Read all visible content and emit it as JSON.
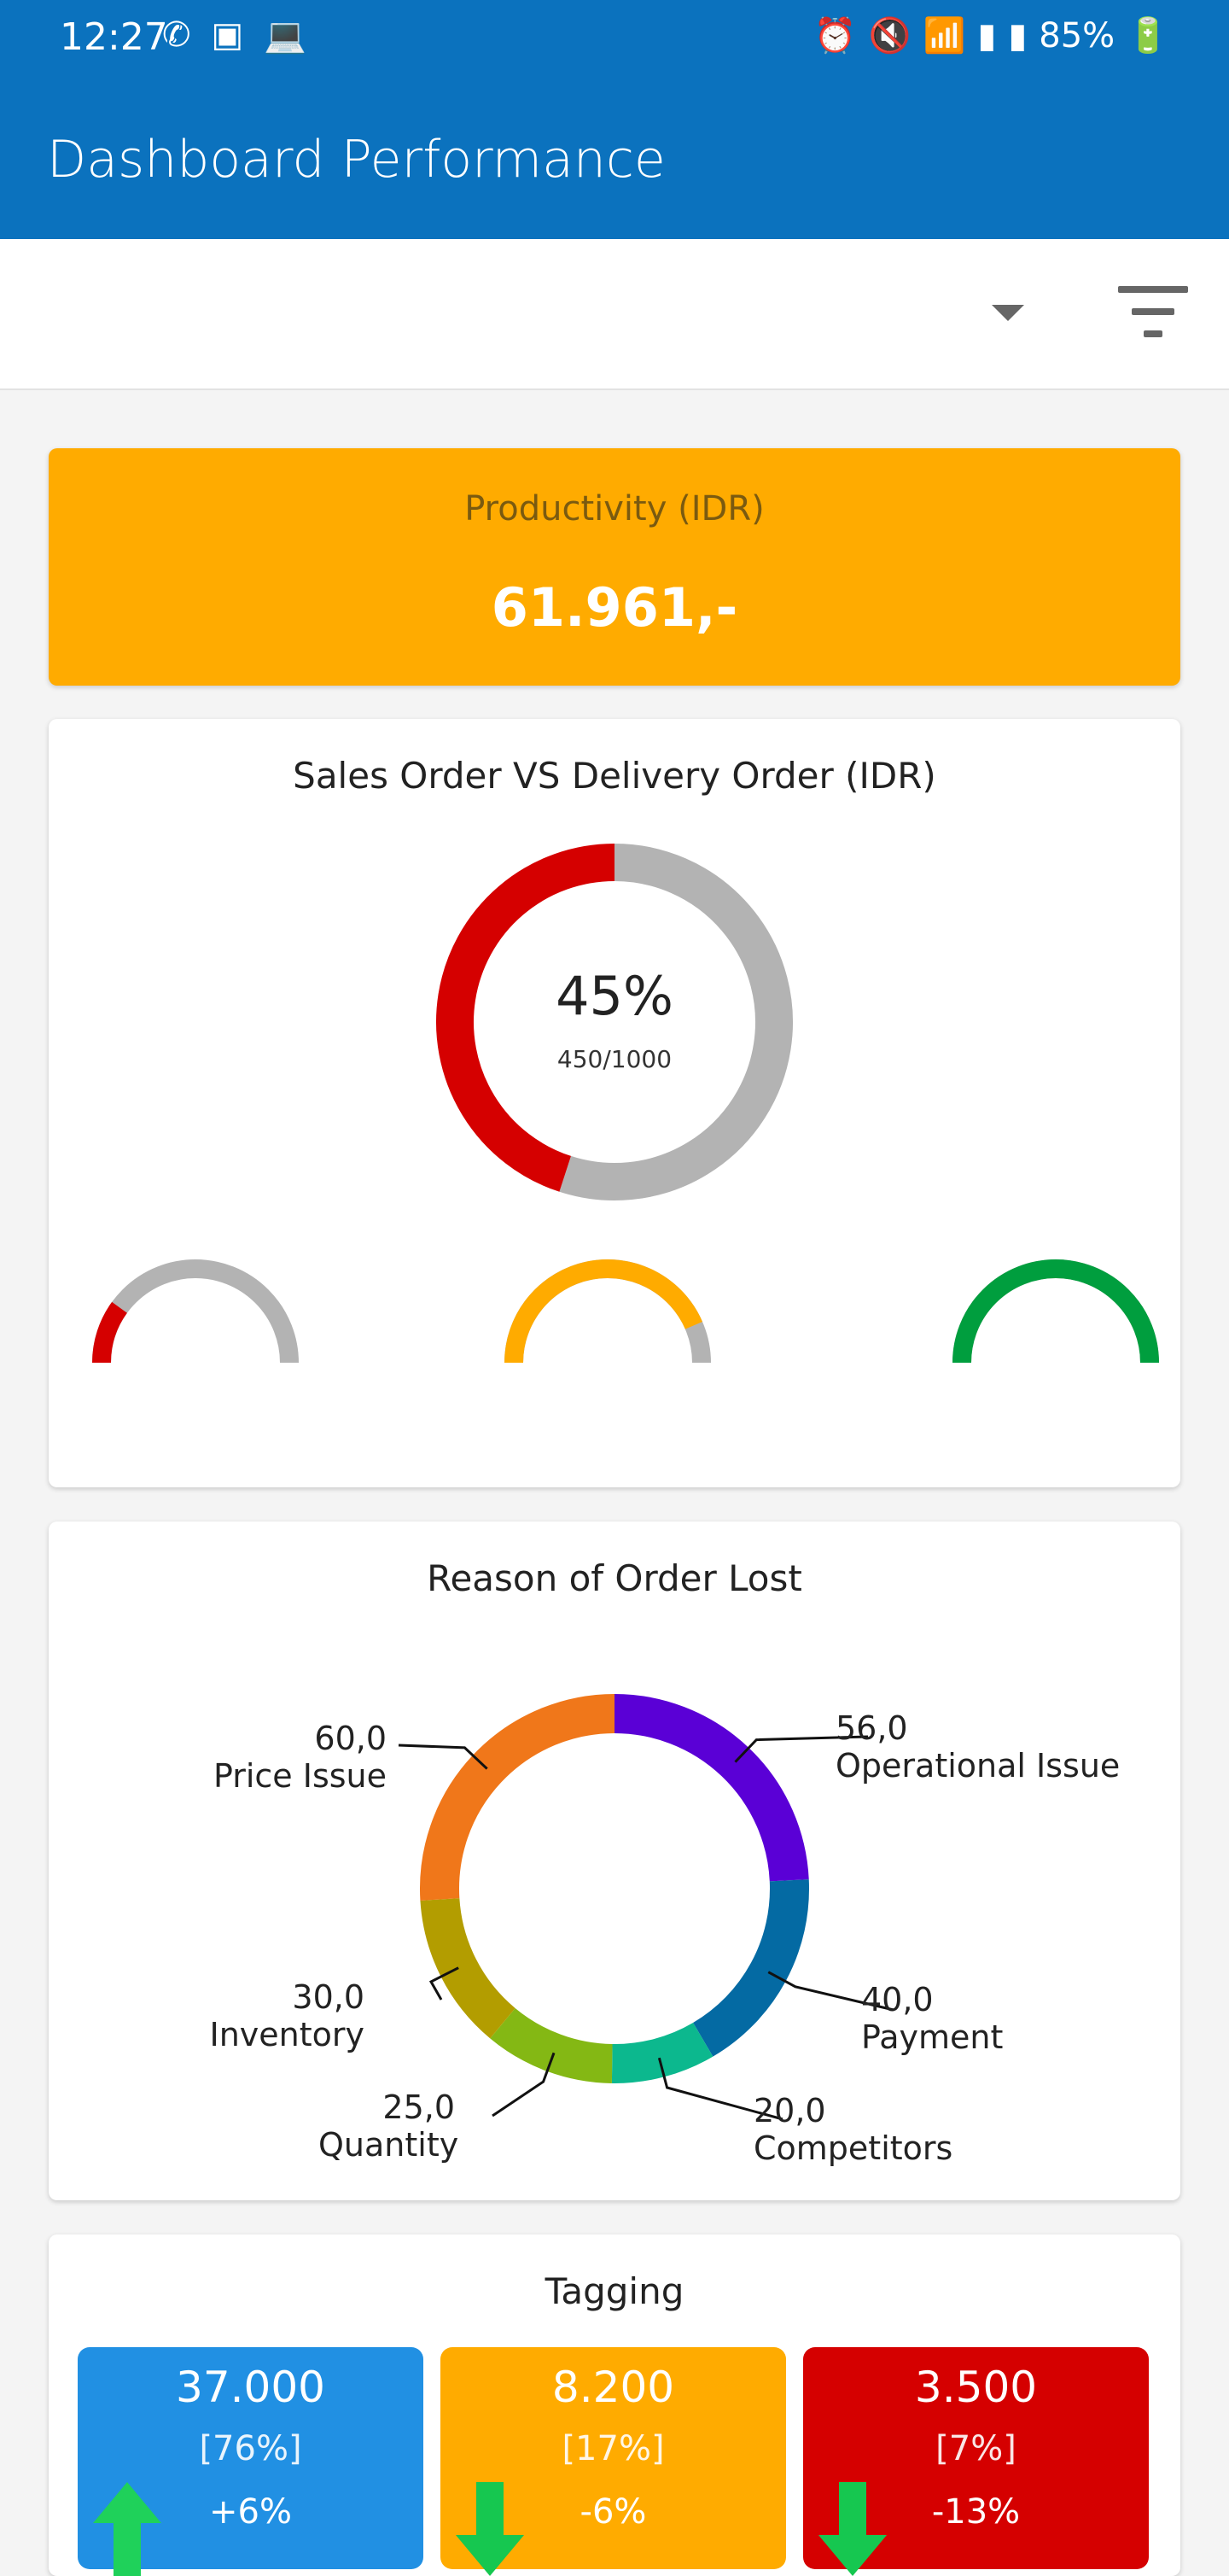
{
  "status_bar": {
    "time": "12:27",
    "battery": "85%",
    "left_icons": [
      "hangouts-icon",
      "image-icon",
      "laptop-icon"
    ],
    "right_icons": [
      "alarm-icon",
      "mute-icon",
      "wifi-icon",
      "signal-icon",
      "signal-icon",
      "battery-charging-icon"
    ]
  },
  "appbar": {
    "title": "Dashboard Performance"
  },
  "toolbar": {
    "icons": [
      "chevron-down-icon",
      "filter-icon"
    ]
  },
  "productivity": {
    "label": "Productivity (IDR)",
    "value": "61.961,-"
  },
  "sales_vs_delivery": {
    "title": "Sales Order VS Delivery Order (IDR)",
    "percent_label": "45%",
    "ratio_label": "450/1000"
  },
  "reason": {
    "title": "Reason of Order Lost"
  },
  "tagging": {
    "title": "Tagging",
    "tiles": [
      {
        "value": "37.000",
        "percent": "[76%]",
        "change": "+6%",
        "direction": "up",
        "color": "#2190e3"
      },
      {
        "value": "8.200",
        "percent": "[17%]",
        "change": "-6%",
        "direction": "down",
        "color": "#ffab00"
      },
      {
        "value": "3.500",
        "percent": "[7%]",
        "change": "-13%",
        "direction": "down",
        "color": "#d50000"
      }
    ]
  },
  "chart_data": [
    {
      "type": "pie",
      "variant": "donut",
      "title": "Sales Order VS Delivery Order (IDR)",
      "values": [
        450,
        550
      ],
      "colors": [
        "#d50000",
        "#b3b3b3"
      ],
      "center_text": "45%",
      "center_subtext": "450/1000"
    },
    {
      "type": "pie",
      "variant": "semi-gauge",
      "gauges": [
        {
          "fraction": 0.2,
          "color": "#d50000",
          "track": "#b3b3b3"
        },
        {
          "fraction": 0.87,
          "color": "#ffab00",
          "track": "#b3b3b3"
        },
        {
          "fraction": 1.0,
          "color": "#009e3e",
          "track": "#b3b3b3"
        }
      ]
    },
    {
      "type": "pie",
      "variant": "donut",
      "title": "Reason of Order Lost",
      "categories": [
        "Operational Issue",
        "Payment",
        "Competitors",
        "Quantity",
        "Inventory",
        "Price Issue"
      ],
      "values": [
        56.0,
        40.0,
        20.0,
        25.0,
        30.0,
        60.0
      ],
      "value_labels": [
        "56,0",
        "40,0",
        "20,0",
        "25,0",
        "30,0",
        "60,0"
      ],
      "colors": [
        "#5a00d6",
        "#046aa3",
        "#0cb88e",
        "#84b814",
        "#b39d00",
        "#f0771a"
      ]
    }
  ]
}
